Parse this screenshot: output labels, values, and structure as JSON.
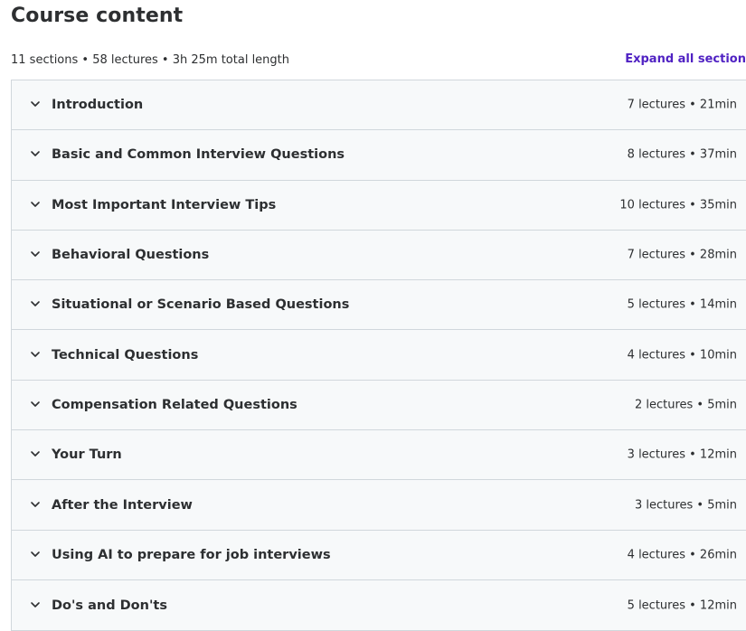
{
  "header": {
    "title": "Course content",
    "summary": "11 sections • 58 lectures • 3h 25m total length",
    "expand_label": "Expand all section"
  },
  "sections": [
    {
      "title": "Introduction",
      "meta": "7 lectures • 21min"
    },
    {
      "title": "Basic and Common Interview Questions",
      "meta": "8 lectures • 37min"
    },
    {
      "title": "Most Important Interview Tips",
      "meta": "10 lectures • 35min"
    },
    {
      "title": "Behavioral Questions",
      "meta": "7 lectures • 28min"
    },
    {
      "title": "Situational or Scenario Based Questions",
      "meta": "5 lectures • 14min"
    },
    {
      "title": "Technical Questions",
      "meta": "4 lectures • 10min"
    },
    {
      "title": "Compensation Related Questions",
      "meta": "2 lectures • 5min"
    },
    {
      "title": "Your Turn",
      "meta": "3 lectures • 12min"
    },
    {
      "title": "After the Interview",
      "meta": "3 lectures • 5min"
    },
    {
      "title": "Using AI to prepare for job interviews",
      "meta": "4 lectures • 26min"
    },
    {
      "title": "Do's and Don'ts",
      "meta": "5 lectures • 12min"
    }
  ],
  "icons": {
    "section_toggle": "chevron-down-icon"
  },
  "colors": {
    "accent": "#5022c3",
    "row_background": "#f7f9fa",
    "border": "#d1d7dc",
    "text": "#2d2f31"
  }
}
